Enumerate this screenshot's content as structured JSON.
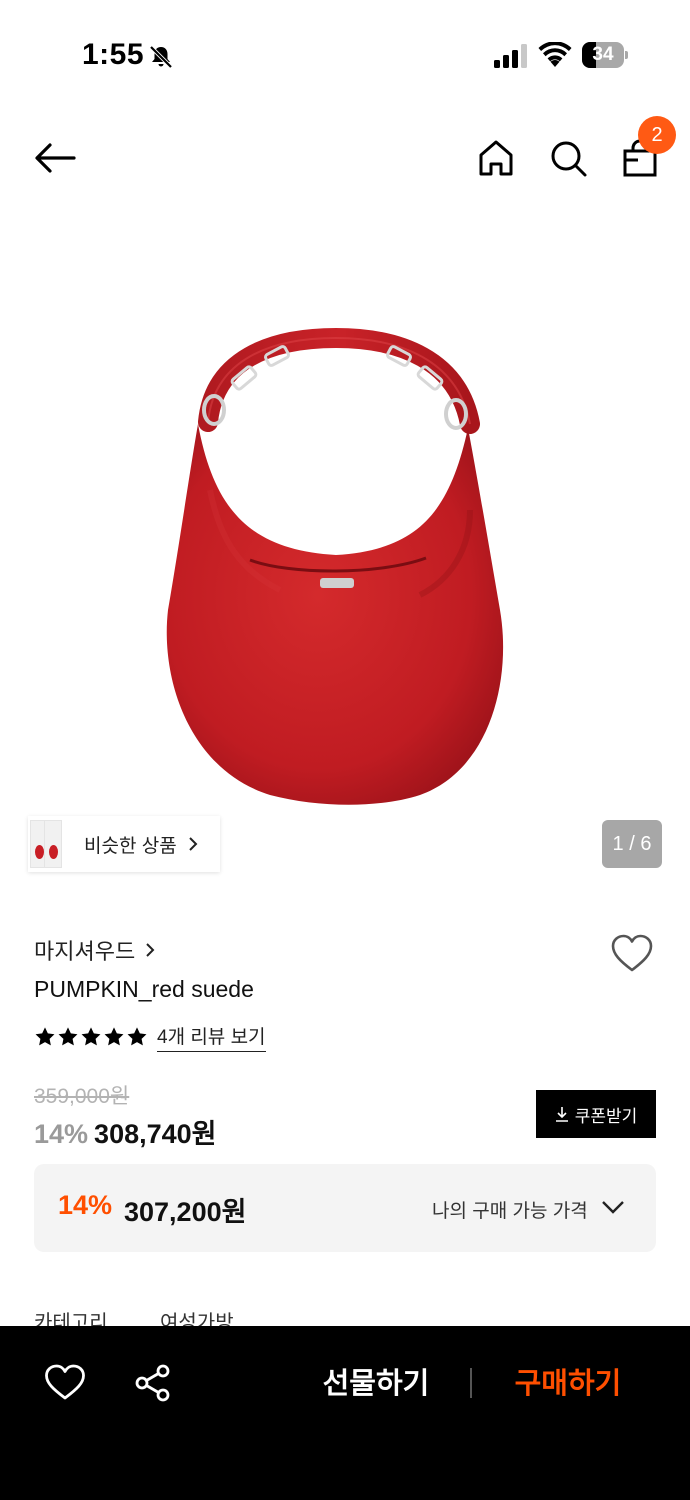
{
  "status_bar": {
    "time": "1:55",
    "battery": "34",
    "battery_level": 0.34
  },
  "header": {
    "cart_count": "2"
  },
  "gallery": {
    "similar_label": "비슷한 상품",
    "counter": "1 / 6"
  },
  "product": {
    "brand": "마지셔우드",
    "name": "PUMPKIN_red suede",
    "rating_stars": 5,
    "review_link": "4개 리뷰 보기",
    "original_price": "359,000원",
    "discount": "14%",
    "price": "308,740원",
    "coupon_label": "쿠폰받기"
  },
  "my_price": {
    "discount": "14%",
    "price": "307,200원",
    "label": "나의 구매 가능 가격"
  },
  "details": {
    "category_label": "카테고리",
    "category_value": "여성가방"
  },
  "bottom_bar": {
    "gift_label": "선물하기",
    "buy_label": "구매하기"
  },
  "colors": {
    "accent": "#ff4f00",
    "badge": "#ff5a14",
    "product_red": "#c81e25"
  }
}
